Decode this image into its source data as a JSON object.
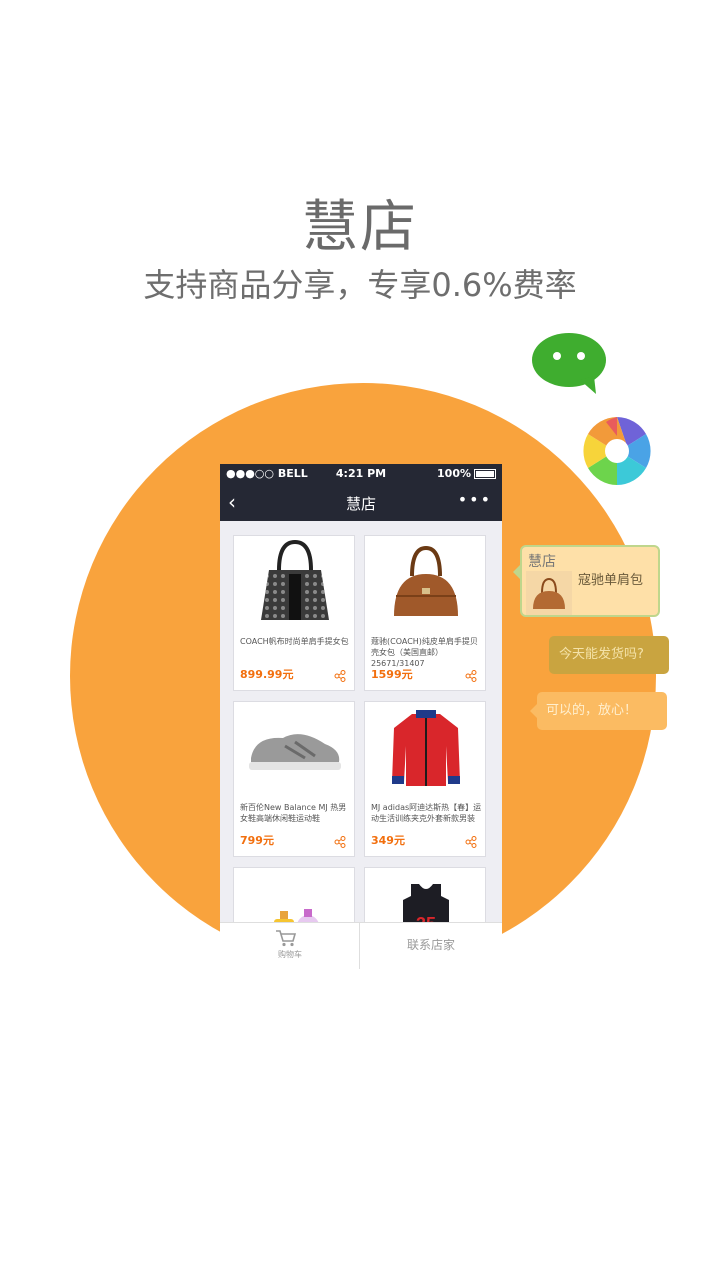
{
  "header": {
    "title": "慧店",
    "subtitle": "支持商品分享，专享0.6%费率"
  },
  "icons": {
    "wechat": "wechat-icon",
    "moments": "moments-aperture-icon"
  },
  "phone": {
    "status": {
      "carrier": "●●●○○ BELL",
      "time": "4:21 PM",
      "battery": "100%"
    },
    "nav": {
      "title": "慧店",
      "back_icon": "‹",
      "more_icon": "•••"
    },
    "products": [
      {
        "name": "COACH帆布时尚单肩手提女包",
        "price": "899.99元",
        "image": "black-handbag"
      },
      {
        "name": "蔻驰(COACH)纯皮单肩手提贝壳女包（美国直邮）25671/31407",
        "price": "1599元",
        "image": "brown-handbag"
      },
      {
        "name": "新百伦New Balance MJ 热男女鞋高端休闲鞋运动鞋",
        "price": "799元",
        "image": "grey-sneaker"
      },
      {
        "name": "MJ adidas阿迪达斯热【春】运动生活训练夹克外套新款男装",
        "price": "349元",
        "image": "red-jacket"
      },
      {
        "name": "",
        "price": "",
        "image": "perfume"
      },
      {
        "name": "",
        "price": "",
        "image": "basketball-jersey"
      }
    ],
    "bottom": {
      "cart_label": "购物车",
      "contact_label": "联系店家"
    }
  },
  "chat": {
    "bubble1_title": "慧店",
    "bubble1_text": "寇驰单肩包",
    "bubble2_text": "今天能发货吗?",
    "bubble3_text": "可以的，放心！"
  },
  "colors": {
    "accent_orange": "#f9a33d",
    "price_orange": "#f26f0e",
    "navbar": "#252834",
    "wechat_green": "#3fad2f"
  }
}
